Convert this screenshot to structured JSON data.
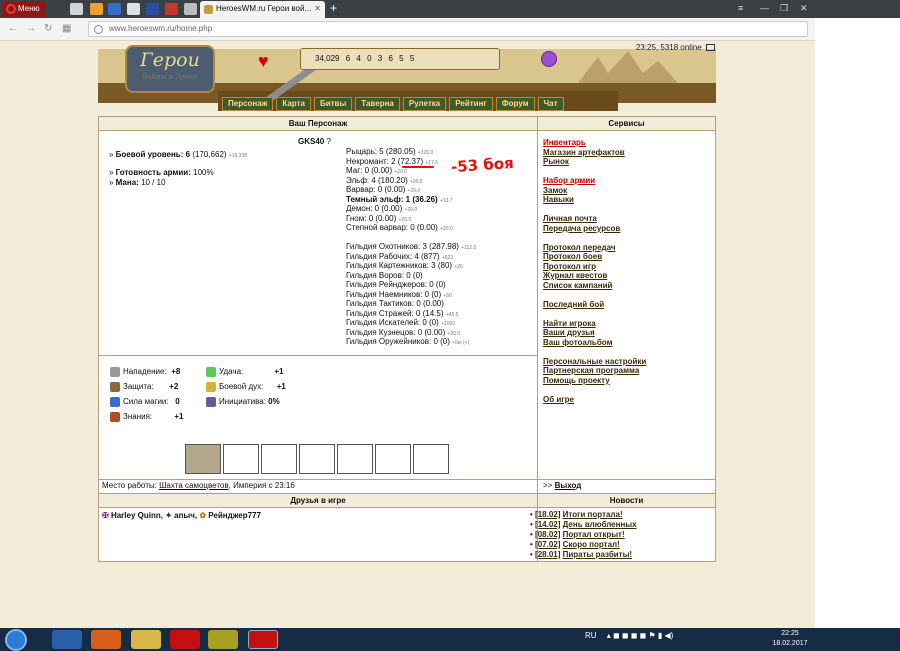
{
  "browser": {
    "menu_label": "Меню",
    "tab_title": "HeroesWM.ru Герои вой...",
    "url": "www.heroeswm.ru/home.php"
  },
  "header": {
    "logo_big": "Герои",
    "logo_small": "Войны и Денег",
    "status": "23:25, 5318 online",
    "resources": [
      "34,029",
      "6",
      "4",
      "0",
      "3",
      "6",
      "5",
      "5"
    ],
    "menu": [
      "Персонаж",
      "Карта",
      "Битвы",
      "Таверна",
      "Рулетка",
      "Рейтинг",
      "Форум",
      "Чат"
    ]
  },
  "character": {
    "section_title": "Ваш Персонаж",
    "nick": "GKS40",
    "level_label": "Боевой уровень:",
    "level_value": "6",
    "level_exp": "(170,662)",
    "level_delta": "+19,338",
    "army_label": "Готовность армии:",
    "army_value": "100%",
    "mana_label": "Мана:",
    "mana_value": "10 / 10"
  },
  "guilds": [
    {
      "text": "Рыцарь: 5 (280.05)",
      "delta": "+320.0"
    },
    {
      "text": "Некромант: 2 (72.37)",
      "delta": "+17.6"
    },
    {
      "text": "Маг: 0 (0.00)",
      "delta": "+20.0"
    },
    {
      "text": "Эльф: 4 (180.20)",
      "delta": "+99.8"
    },
    {
      "text": "Варвар: 0 (0.00)",
      "delta": "+20.0"
    },
    {
      "text": "Темный эльф: 1 (36.26)",
      "delta": "+13.7"
    },
    {
      "text": "Демон: 0 (0.00)",
      "delta": "+20.0"
    },
    {
      "text": "Гном: 0 (0.00)",
      "delta": "+20.0"
    },
    {
      "text": "Степной варвар: 0 (0.00)",
      "delta": "+20.0"
    },
    {
      "text": "",
      "delta": ""
    },
    {
      "text": "Гильдия Охотников: 3 (287.98)",
      "delta": "+112.0"
    },
    {
      "text": "Гильдия Рабочих: 4 (877)",
      "delta": "+623"
    },
    {
      "text": "Гильдия Картежников: 3 (80)",
      "delta": "+20"
    },
    {
      "text": "Гильдия Воров: 0 (0)",
      "delta": ""
    },
    {
      "text": "Гильдия Рейнджеров: 0 (0)",
      "delta": ""
    },
    {
      "text": "Гильдия Наемников: 0 (0)",
      "delta": "+50"
    },
    {
      "text": "Гильдия Тактиков: 0 (0.00)",
      "delta": ""
    },
    {
      "text": "Гильдия Стражей: 0 (14.5)",
      "delta": "+45.5"
    },
    {
      "text": "Гильдия Искателей: 0 (0)",
      "delta": "+1000"
    },
    {
      "text": "Гильдия Кузнецов: 0 (0.00)",
      "delta": "+30.0"
    },
    {
      "text": "Гильдия Оружейников: 0 (0)",
      "delta": "+0ю (+)"
    }
  ],
  "annotation": "-53 боя",
  "stats": {
    "attack_label": "Нападение:",
    "attack": "+8",
    "defense_label": "Защита:",
    "defense": "+2",
    "spell_label": "Сила магии:",
    "spell": "0",
    "knowledge_label": "Знания:",
    "knowledge": "+1",
    "luck_label": "Удача:",
    "luck": "+1",
    "morale_label": "Боевой дух:",
    "morale": "+1",
    "init_label": "Инициатива:",
    "init": "0%"
  },
  "services": {
    "title": "Сервисы",
    "groups": [
      [
        {
          "label": "Инвентарь",
          "red": true
        },
        {
          "label": "Магазин артефактов"
        },
        {
          "label": "Рынок"
        }
      ],
      [
        {
          "label": "Набор армии",
          "red": true
        },
        {
          "label": "Замок"
        },
        {
          "label": "Навыки"
        }
      ],
      [
        {
          "label": "Личная почта"
        },
        {
          "label": "Передача ресурсов"
        }
      ],
      [
        {
          "label": "Протокол передач"
        },
        {
          "label": "Протокол боев"
        },
        {
          "label": "Протокол игр"
        },
        {
          "label": "Журнал квестов"
        },
        {
          "label": "Список кампаний"
        }
      ],
      [
        {
          "label": "Последний бой"
        }
      ],
      [
        {
          "label": "Найти игрока"
        },
        {
          "label": "Ваши друзья"
        },
        {
          "label": "Ваш фотоальбом"
        }
      ],
      [
        {
          "label": "Персональные настройки"
        },
        {
          "label": "Партнерская программа"
        },
        {
          "label": "Помощь проекту"
        }
      ],
      [
        {
          "label": "Об игре"
        }
      ]
    ]
  },
  "work": {
    "prefix": "Место работы:",
    "place": "Шахта самоцветов",
    "suffix": ", Империя с 23:16",
    "exit_prefix": ">>",
    "exit": "Выход"
  },
  "friends": {
    "title": "Друзья в игре",
    "list": [
      "Harley Quinn",
      "апыч",
      "Рейнджер777"
    ]
  },
  "news": {
    "title": "Новости",
    "items": [
      {
        "date": "[18.02]",
        "title": "Итоги портала!"
      },
      {
        "date": "[14.02]",
        "title": "День влюбленных"
      },
      {
        "date": "[08.02]",
        "title": "Портал открыт!"
      },
      {
        "date": "[07.02]",
        "title": "Скоро портал!"
      },
      {
        "date": "[28.01]",
        "title": "Пираты разбиты!"
      }
    ]
  },
  "taskbar": {
    "lang": "RU",
    "time": "22:25",
    "date": "18.02.2017"
  }
}
